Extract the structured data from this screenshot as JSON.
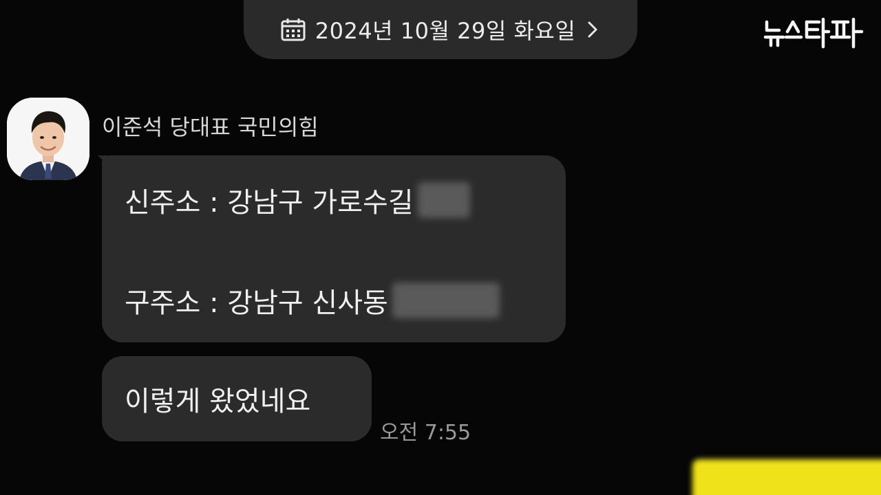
{
  "header": {
    "date_label": "2024년 10월 29일 화요일",
    "calendar_icon": "calendar-icon",
    "chevron_icon": "chevron-right-icon"
  },
  "watermark": {
    "logo_text": "뉴스타파",
    "logo_icon": "newstapa-logo"
  },
  "chat": {
    "sender_name": "이준석 당대표 국민의힘",
    "avatar_icon": "profile-photo",
    "messages": [
      {
        "line1": "신주소 : 강남구 가로수길",
        "line2": "구주소 : 강남구 신사동"
      },
      {
        "text": "이렇게 왔었네요"
      }
    ],
    "timestamp": "오전 7:55"
  },
  "colors": {
    "background": "#060606",
    "bubble": "#2b2b2b",
    "pill": "#2a2a2a",
    "highlight": "#f0e21a"
  }
}
